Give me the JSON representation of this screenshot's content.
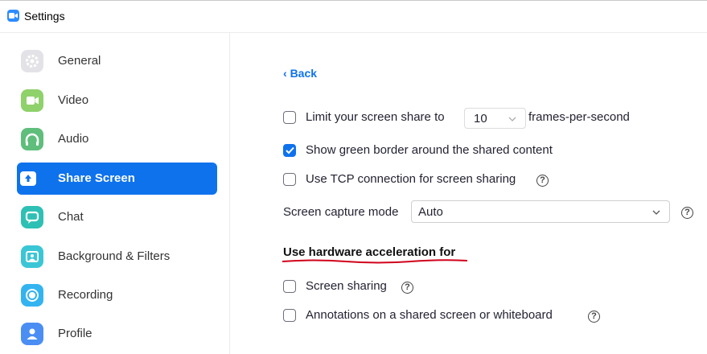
{
  "window": {
    "title": "Settings"
  },
  "sidebar": {
    "items": [
      {
        "label": "General",
        "icon": "gear-icon",
        "color": "#E3E3E7",
        "active": false
      },
      {
        "label": "Video",
        "icon": "video-camera-icon",
        "color": "#8FD16A",
        "active": false
      },
      {
        "label": "Audio",
        "icon": "headphones-icon",
        "color": "#5FBE7B",
        "active": false
      },
      {
        "label": "Share Screen",
        "icon": "share-screen-icon",
        "color": "#0E72ED",
        "active": true
      },
      {
        "label": "Chat",
        "icon": "chat-bubble-icon",
        "color": "#2FC0B5",
        "active": false
      },
      {
        "label": "Background & Filters",
        "icon": "background-icon",
        "color": "#3BC6D6",
        "active": false
      },
      {
        "label": "Recording",
        "icon": "record-icon",
        "color": "#33B4F0",
        "active": false
      },
      {
        "label": "Profile",
        "icon": "user-icon",
        "color": "#4A8EF3",
        "active": false
      }
    ]
  },
  "content": {
    "back_label": "Back",
    "limit_fps": {
      "label": "Limit your screen share to",
      "value": "10",
      "suffix": "frames-per-second",
      "checked": false
    },
    "green_border": {
      "label": "Show green border around the shared content",
      "checked": true
    },
    "tcp": {
      "label": "Use TCP connection for screen sharing",
      "checked": false
    },
    "capture_mode": {
      "label": "Screen capture mode",
      "value": "Auto"
    },
    "hardware_heading": "Use hardware acceleration for",
    "hw_screen_sharing": {
      "label": "Screen sharing",
      "checked": false
    },
    "hw_annotations": {
      "label": "Annotations on a shared screen or whiteboard",
      "checked": false
    }
  },
  "colors": {
    "accent": "#0E72ED",
    "brand": "#2D8CFF",
    "annotation": "#D0021B"
  }
}
